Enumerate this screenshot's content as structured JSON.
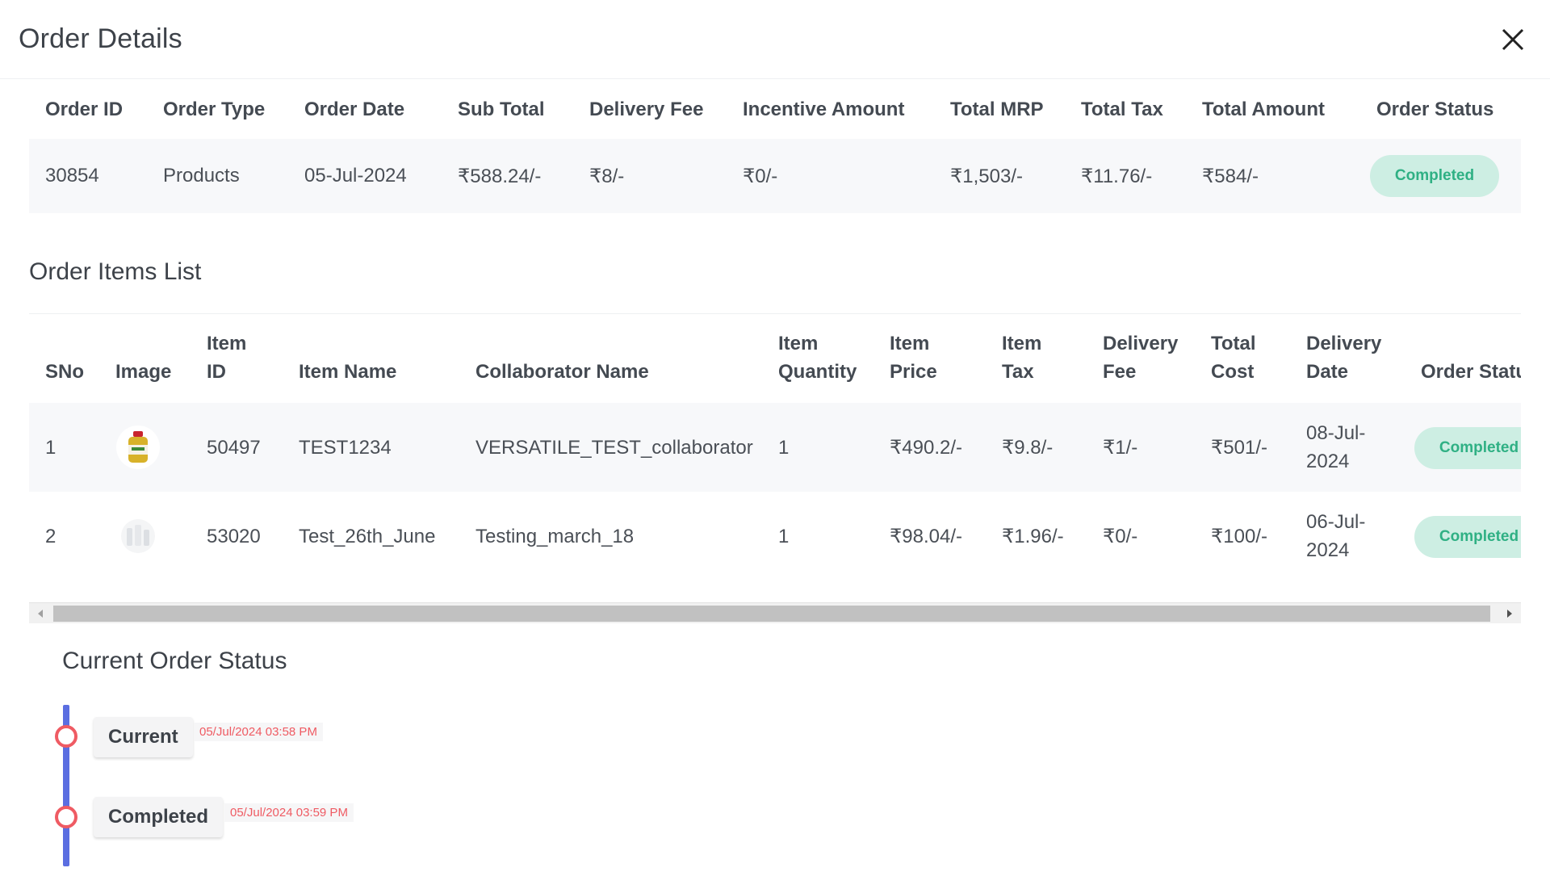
{
  "modal": {
    "title": "Order Details"
  },
  "summary": {
    "headers": [
      "Order ID",
      "Order Type",
      "Order Date",
      "Sub Total",
      "Delivery Fee",
      "Incentive Amount",
      "Total MRP",
      "Total Tax",
      "Total Amount",
      "Order Status"
    ],
    "row": {
      "order_id": "30854",
      "order_type": "Products",
      "order_date": "05-Jul-2024",
      "sub_total": "₹588.24/-",
      "delivery_fee": "₹8/-",
      "incentive_amount": "₹0/-",
      "total_mrp": "₹1,503/-",
      "total_tax": "₹11.76/-",
      "total_amount": "₹584/-",
      "order_status": "Completed"
    }
  },
  "items": {
    "section_title": "Order Items List",
    "headers": {
      "sno": "SNo",
      "image": "Image",
      "item_id_1": "Item",
      "item_id_2": "ID",
      "item_name": "Item Name",
      "collaborator_name": "Collaborator Name",
      "qty_1": "Item",
      "qty_2": "Quantity",
      "price_1": "Item",
      "price_2": "Price",
      "tax_1": "Item",
      "tax_2": "Tax",
      "fee_1": "Delivery",
      "fee_2": "Fee",
      "cost_1": "Total",
      "cost_2": "Cost",
      "date_1": "Delivery",
      "date_2": "Date",
      "status": "Order Status"
    },
    "rows": [
      {
        "sno": "1",
        "item_id": "50497",
        "item_name": "TEST1234",
        "collaborator_name": "VERSATILE_TEST_collaborator",
        "quantity": "1",
        "price": "₹490.2/-",
        "tax": "₹9.8/-",
        "delivery_fee": "₹1/-",
        "total_cost": "₹501/-",
        "delivery_date_1": "08-Jul-",
        "delivery_date_2": "2024",
        "status": "Completed"
      },
      {
        "sno": "2",
        "item_id": "53020",
        "item_name": "Test_26th_June",
        "collaborator_name": "Testing_march_18",
        "quantity": "1",
        "price": "₹98.04/-",
        "tax": "₹1.96/-",
        "delivery_fee": "₹0/-",
        "total_cost": "₹100/-",
        "delivery_date_1": "06-Jul-",
        "delivery_date_2": "2024",
        "status": "Completed"
      }
    ]
  },
  "status_timeline": {
    "title": "Current Order Status",
    "events": [
      {
        "label": "Current",
        "time": "05/Jul/2024 03:58 PM"
      },
      {
        "label": "Completed",
        "time": "05/Jul/2024 03:59 PM"
      }
    ]
  },
  "colors": {
    "badge_bg": "#cdeee3",
    "badge_text": "#2fb084",
    "timeline_line": "#5b6ee1",
    "timeline_dot": "#ef5b63"
  }
}
